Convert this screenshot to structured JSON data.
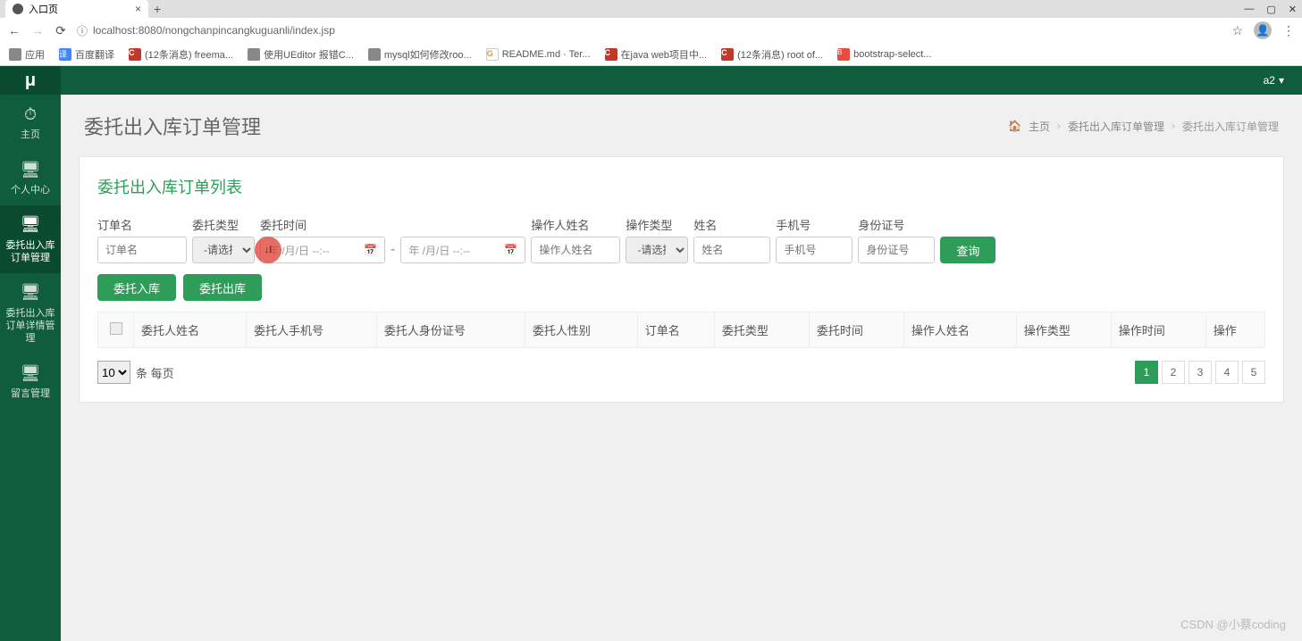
{
  "browser": {
    "tab_title": "入口页",
    "url": "localhost:8080/nongchanpincangkuguanli/index.jsp",
    "apps_label": "应用",
    "bookmarks": [
      {
        "label": "百度翻译",
        "icon": "ic-blue",
        "glyph": "译"
      },
      {
        "label": "(12条消息) freema...",
        "icon": "ic-red",
        "glyph": "C"
      },
      {
        "label": "使用UEditor 报错C...",
        "icon": "ic-gray",
        "glyph": ""
      },
      {
        "label": "mysql如何修改roo...",
        "icon": "ic-gray",
        "glyph": ""
      },
      {
        "label": "README.md · Ter...",
        "icon": "ic-g",
        "glyph": "G"
      },
      {
        "label": "在java web项目中...",
        "icon": "ic-red",
        "glyph": "C"
      },
      {
        "label": "(12条消息) root of...",
        "icon": "ic-red",
        "glyph": "C"
      },
      {
        "label": "bootstrap-select...",
        "icon": "ic-green",
        "glyph": "B"
      }
    ]
  },
  "topbar": {
    "logo": "μ",
    "user": "a2"
  },
  "sidebar": {
    "items": [
      {
        "label": "主页",
        "icon": "⏱"
      },
      {
        "label": "个人中心",
        "icon": "🖥"
      },
      {
        "label": "委托出入库订单管理",
        "icon": "🖥"
      },
      {
        "label": "委托出入库订单详情管理",
        "icon": "🖥"
      },
      {
        "label": "留言管理",
        "icon": "🖥"
      }
    ]
  },
  "header": {
    "title": "委托出入库订单管理",
    "crumb_home": "主页",
    "crumb_1": "委托出入库订单管理",
    "crumb_2": "委托出入库订单管理"
  },
  "panel": {
    "title": "委托出入库订单列表"
  },
  "filters": {
    "order_name": {
      "label": "订单名",
      "placeholder": "订单名"
    },
    "type": {
      "label": "委托类型",
      "placeholder": "-请选择-"
    },
    "time": {
      "label": "委托时间",
      "placeholder": "年 /月/日 --:--"
    },
    "operator": {
      "label": "操作人姓名",
      "placeholder": "操作人姓名"
    },
    "op_type": {
      "label": "操作类型",
      "placeholder": "-请选择-"
    },
    "name": {
      "label": "姓名",
      "placeholder": "姓名"
    },
    "phone": {
      "label": "手机号",
      "placeholder": "手机号"
    },
    "idcard": {
      "label": "身份证号",
      "placeholder": "身份证号"
    },
    "query": "查询"
  },
  "actions": {
    "in": "委托入库",
    "out": "委托出库"
  },
  "table": {
    "headers": [
      "委托人姓名",
      "委托人手机号",
      "委托人身份证号",
      "委托人性别",
      "订单名",
      "委托类型",
      "委托时间",
      "操作人姓名",
      "操作类型",
      "操作时间",
      "操作"
    ]
  },
  "footer": {
    "page_size": "10",
    "per_page_text": "条 每页",
    "pages": [
      "1",
      "2",
      "3",
      "4",
      "5"
    ]
  },
  "click_marker": "↓I",
  "watermark": "CSDN @小蔡coding"
}
